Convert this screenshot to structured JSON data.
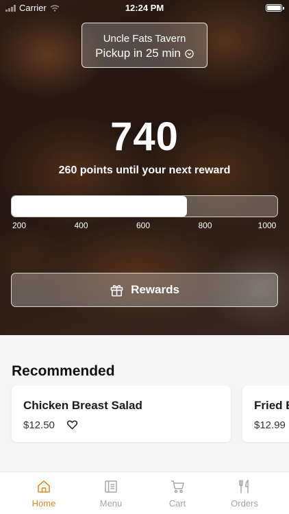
{
  "status_bar": {
    "carrier": "Carrier",
    "time": "12:24 PM"
  },
  "store": {
    "name": "Uncle Fats Tavern",
    "pickup": "Pickup in 25 min"
  },
  "rewards": {
    "points": "740",
    "until_text": "260 points until your next reward",
    "progress_value": 740,
    "range": [
      200,
      1000
    ],
    "ticks": [
      "200",
      "400",
      "600",
      "800",
      "1000"
    ],
    "button_label": "Rewards"
  },
  "recommended": {
    "title": "Recommended",
    "items": [
      {
        "name": "Chicken Breast Salad",
        "price": "$12.50"
      },
      {
        "name": "Fried B",
        "price": "$12.99"
      }
    ]
  },
  "tabs": [
    {
      "label": "Home",
      "icon": "home-icon",
      "active": true
    },
    {
      "label": "Menu",
      "icon": "menu-icon",
      "active": false
    },
    {
      "label": "Cart",
      "icon": "cart-icon",
      "active": false
    },
    {
      "label": "Orders",
      "icon": "fork-knife-icon",
      "active": false
    }
  ],
  "colors": {
    "accent": "#e58a1f",
    "inactive_tab": "#a6a6a6"
  }
}
